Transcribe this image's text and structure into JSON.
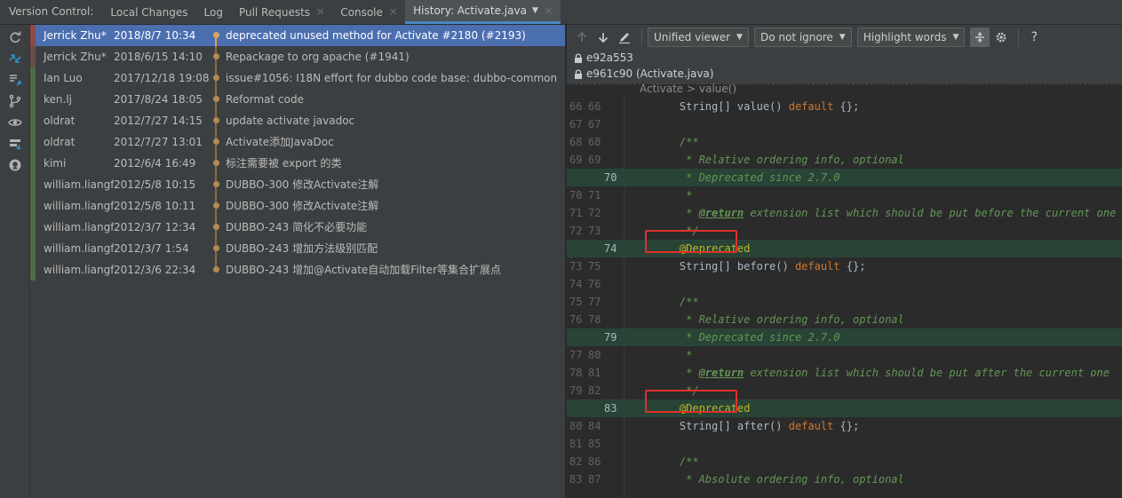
{
  "tabbar": {
    "label": "Version Control:",
    "tabs": [
      {
        "label": "Local Changes",
        "closable": false
      },
      {
        "label": "Log",
        "closable": false
      },
      {
        "label": "Pull Requests",
        "closable": true
      },
      {
        "label": "Console",
        "closable": true
      },
      {
        "label": "History: Activate.java",
        "closable": true
      }
    ]
  },
  "commits": [
    {
      "author": "Jerrick Zhu*",
      "date": "2018/8/7 10:34",
      "message": "deprecated unused method for Activate #2180 (#2193)",
      "selected": true
    },
    {
      "author": "Jerrick Zhu*",
      "date": "2018/6/15 14:10",
      "message": "Repackage to org apache (#1941)",
      "selected": false
    },
    {
      "author": "Ian Luo",
      "date": "2017/12/18 19:08",
      "message": "issue#1056: I18N effort for dubbo code base: dubbo-common",
      "selected": false
    },
    {
      "author": "ken.lj",
      "date": "2017/8/24 18:05",
      "message": "Reformat code",
      "selected": false
    },
    {
      "author": "oldrat",
      "date": "2012/7/27 14:15",
      "message": "update activate javadoc",
      "selected": false
    },
    {
      "author": "oldrat",
      "date": "2012/7/27 13:01",
      "message": "Activate添加JavaDoc",
      "selected": false
    },
    {
      "author": "kimi",
      "date": "2012/6/4 16:49",
      "message": "标注需要被 export 的类",
      "selected": false
    },
    {
      "author": "william.liangf",
      "date": "2012/5/8 10:15",
      "message": "DUBBO-300 修改Activate注解",
      "selected": false
    },
    {
      "author": "william.liangf",
      "date": "2012/5/8 10:11",
      "message": "DUBBO-300 修改Activate注解",
      "selected": false
    },
    {
      "author": "william.liangf",
      "date": "2012/3/7 12:34",
      "message": "DUBBO-243 简化不必要功能",
      "selected": false
    },
    {
      "author": "william.liangf",
      "date": "2012/3/7 1:54",
      "message": "DUBBO-243 增加方法级别匹配",
      "selected": false
    },
    {
      "author": "william.liangf",
      "date": "2012/3/6 22:34",
      "message": "DUBBO-243 增加@Activate自动加载Filter等集合扩展点",
      "selected": false
    }
  ],
  "toolbar": {
    "viewer": "Unified viewer",
    "ignore": "Do not ignore",
    "highlight": "Highlight words",
    "help": "?"
  },
  "revisions": [
    "e92a553",
    "e961c90 (Activate.java)"
  ],
  "breadcrumb": "Activate > value()",
  "code_lines": [
    {
      "old": "66",
      "new": "66",
      "added": false,
      "code": "    String[] value() default {};"
    },
    {
      "old": "67",
      "new": "67",
      "added": false,
      "code": ""
    },
    {
      "old": "68",
      "new": "68",
      "added": false,
      "code": "    /**"
    },
    {
      "old": "69",
      "new": "69",
      "added": false,
      "code": "     * Relative ordering info, optional"
    },
    {
      "old": "",
      "new": "70",
      "added": true,
      "code": "     * Deprecated since 2.7.0"
    },
    {
      "old": "70",
      "new": "71",
      "added": false,
      "code": "     *"
    },
    {
      "old": "71",
      "new": "72",
      "added": false,
      "code": "     * @return extension list which should be put before the current one"
    },
    {
      "old": "72",
      "new": "73",
      "added": false,
      "code": "     */"
    },
    {
      "old": "",
      "new": "74",
      "added": true,
      "code": "    @Deprecated"
    },
    {
      "old": "73",
      "new": "75",
      "added": false,
      "code": "    String[] before() default {};"
    },
    {
      "old": "74",
      "new": "76",
      "added": false,
      "code": ""
    },
    {
      "old": "75",
      "new": "77",
      "added": false,
      "code": "    /**"
    },
    {
      "old": "76",
      "new": "78",
      "added": false,
      "code": "     * Relative ordering info, optional"
    },
    {
      "old": "",
      "new": "79",
      "added": true,
      "code": "     * Deprecated since 2.7.0"
    },
    {
      "old": "77",
      "new": "80",
      "added": false,
      "code": "     *"
    },
    {
      "old": "78",
      "new": "81",
      "added": false,
      "code": "     * @return extension list which should be put after the current one"
    },
    {
      "old": "79",
      "new": "82",
      "added": false,
      "code": "     */"
    },
    {
      "old": "",
      "new": "83",
      "added": true,
      "code": "    @Deprecated"
    },
    {
      "old": "80",
      "new": "84",
      "added": false,
      "code": "    String[] after() default {};"
    },
    {
      "old": "81",
      "new": "85",
      "added": false,
      "code": ""
    },
    {
      "old": "82",
      "new": "86",
      "added": false,
      "code": "    /**"
    },
    {
      "old": "83",
      "new": "87",
      "added": false,
      "code": "     * Absolute ordering info, optional"
    }
  ],
  "colors": {
    "selection": "#4b6eaf",
    "added_line": "#294436",
    "highlight_box": "#e0302a",
    "keyword": "#cc7832",
    "comment": "#629755",
    "annotation": "#bbb529"
  }
}
